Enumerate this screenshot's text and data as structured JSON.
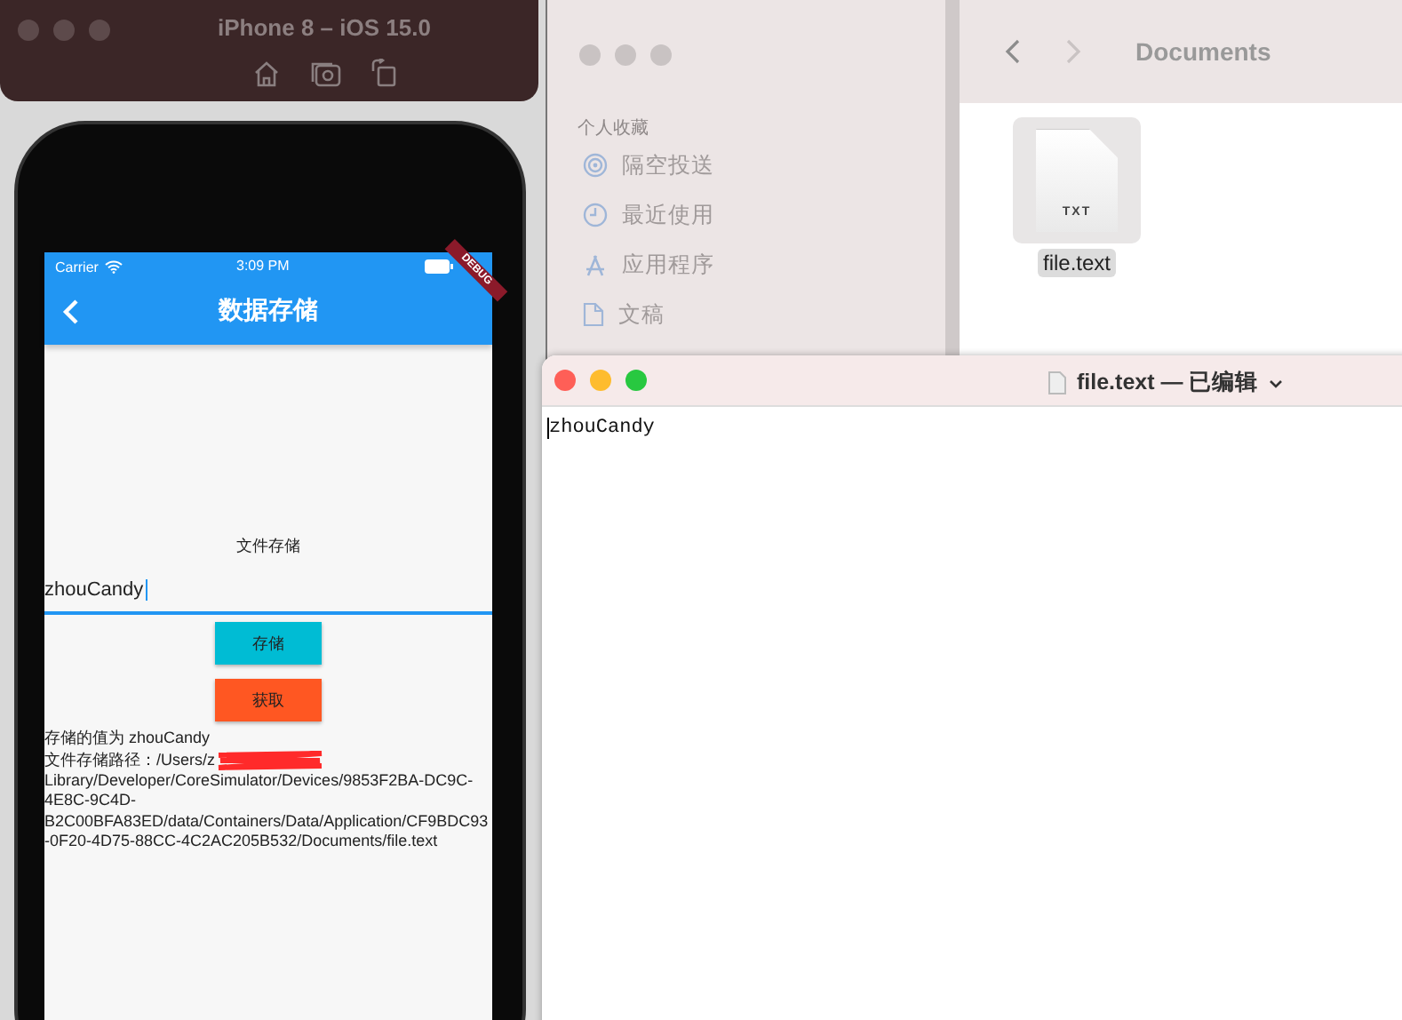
{
  "simulator": {
    "title": "iPhone 8 – iOS 15.0"
  },
  "phone": {
    "status": {
      "carrier": "Carrier",
      "time": "3:09 PM"
    },
    "appbar": {
      "title": "数据存储"
    },
    "debug_banner": "DEBUG",
    "section_label": "文件存储",
    "input": {
      "value": "zhouCandy"
    },
    "buttons": [
      {
        "label": "存储",
        "color": "#00bcd4"
      },
      {
        "label": "获取",
        "color": "#ff5722"
      }
    ],
    "stored_value": "存储的值为  zhouCandy",
    "path_prefix": "文件存储路径：/Users/z",
    "path_rest": "Library/Developer/CoreSimulator/Devices/9853F2BA-DC9C-4E8C-9C4D-B2C00BFA83ED/data/Containers/Data/Application/CF9BDC93-0F20-4D75-88CC-4C2AC205B532/Documents/file.text"
  },
  "finder": {
    "location": "Documents",
    "sidebar_heading": "个人收藏",
    "sidebar_items": [
      {
        "kind": "airdrop",
        "label": "隔空投送"
      },
      {
        "kind": "recent",
        "label": "最近使用"
      },
      {
        "kind": "apps",
        "label": "应用程序"
      },
      {
        "kind": "documents",
        "label": "文稿"
      }
    ],
    "files": [
      {
        "name": "file.text",
        "badge": "TXT",
        "selected": true
      }
    ]
  },
  "textedit": {
    "title": "file.text — 已编辑",
    "content": "zhouCandy"
  }
}
